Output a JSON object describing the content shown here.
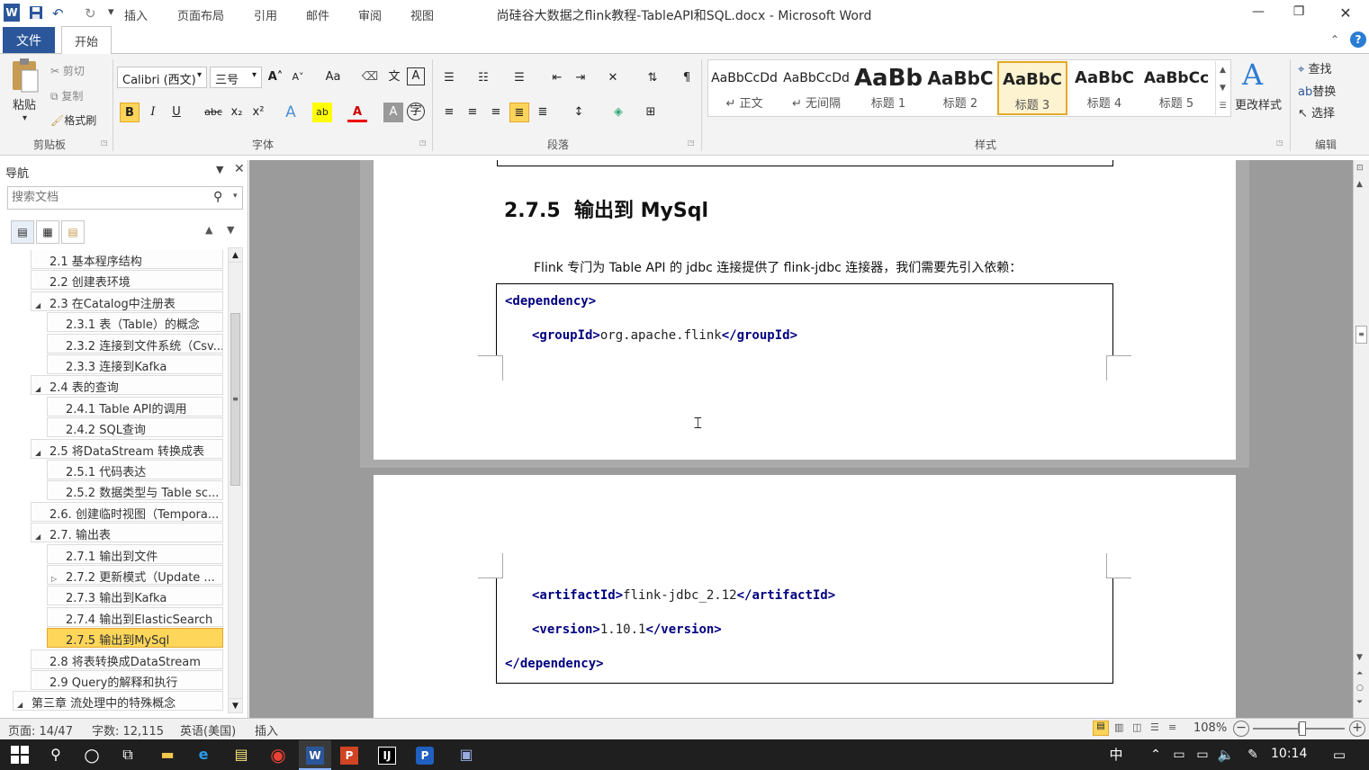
{
  "window": {
    "title": "尚硅谷大数据之flink教程-TableAPI和SQL.docx - Microsoft Word",
    "minimize": "—",
    "restore": "❐",
    "close": "✕"
  },
  "quick_access": {
    "app_icon": "W",
    "save": "💾",
    "undo": "↶",
    "redo": "↻",
    "customize": "▾"
  },
  "tabs": [
    "插入",
    "页面布局",
    "引用",
    "邮件",
    "审阅",
    "视图"
  ],
  "tab_file": "文件",
  "tab_home": "开始",
  "help": "?",
  "collapse": "⌃",
  "clipboard": {
    "paste": "粘贴",
    "cut": "剪切",
    "copy": "复制",
    "format_painter": "格式刷",
    "group": "剪贴板"
  },
  "font": {
    "name": "Calibri (西文)",
    "size": "三号",
    "group": "字体",
    "bold": "B",
    "italic": "I",
    "underline": "U",
    "strike": "abc",
    "sub": "x₂",
    "sup": "x²",
    "grow": "A˄",
    "shrink": "A˅",
    "case": "Aa",
    "clear": "A",
    "font_color": "A",
    "char_border": "A",
    "phonetic": "文",
    "enclose": "字"
  },
  "paragraph": {
    "group": "段落"
  },
  "styles": {
    "group": "样式",
    "items": [
      {
        "sample": "AaBbCcDd",
        "name": "↵ 正文"
      },
      {
        "sample": "AaBbCcDd",
        "name": "↵ 无间隔"
      },
      {
        "sample": "AaBb",
        "name": "标题 1"
      },
      {
        "sample": "AaBbC",
        "name": "标题 2"
      },
      {
        "sample": "AaBbC",
        "name": "标题 3"
      },
      {
        "sample": "AaBbC",
        "name": "标题 4"
      },
      {
        "sample": "AaBbCc",
        "name": "标题 5"
      }
    ],
    "change": "更改样式"
  },
  "editing": {
    "group": "编辑",
    "find": "查找",
    "replace": "替换",
    "select": "选择"
  },
  "nav": {
    "title": "导航",
    "search_placeholder": "搜索文档",
    "items": [
      {
        "label": "2.1 基本程序结构",
        "level": 1,
        "expander": ""
      },
      {
        "label": "2.2 创建表环境",
        "level": 1,
        "expander": ""
      },
      {
        "label": "2.3 在Catalog中注册表",
        "level": 1,
        "expander": "◢"
      },
      {
        "label": "2.3.1 表（Table）的概念",
        "level": 2,
        "expander": ""
      },
      {
        "label": "2.3.2 连接到文件系统（Csv...",
        "level": 2,
        "expander": ""
      },
      {
        "label": "2.3.3 连接到Kafka",
        "level": 2,
        "expander": ""
      },
      {
        "label": "2.4 表的查询",
        "level": 1,
        "expander": "◢"
      },
      {
        "label": "2.4.1 Table API的调用",
        "level": 2,
        "expander": ""
      },
      {
        "label": "2.4.2 SQL查询",
        "level": 2,
        "expander": ""
      },
      {
        "label": "2.5 将DataStream 转换成表",
        "level": 1,
        "expander": "◢"
      },
      {
        "label": "2.5.1 代码表达",
        "level": 2,
        "expander": ""
      },
      {
        "label": "2.5.2 数据类型与 Table sc...",
        "level": 2,
        "expander": ""
      },
      {
        "label": "2.6. 创建临时视图（Tempora...",
        "level": 1,
        "expander": ""
      },
      {
        "label": "2.7. 输出表",
        "level": 1,
        "expander": "◢"
      },
      {
        "label": "2.7.1 输出到文件",
        "level": 2,
        "expander": ""
      },
      {
        "label": "2.7.2 更新模式（Update ...",
        "level": 2,
        "expander": "▷"
      },
      {
        "label": "2.7.3 输出到Kafka",
        "level": 2,
        "expander": ""
      },
      {
        "label": "2.7.4 输出到ElasticSearch",
        "level": 2,
        "expander": ""
      },
      {
        "label": "2.7.5 输出到MySql",
        "level": 2,
        "expander": "",
        "active": true
      },
      {
        "label": "2.8 将表转换成DataStream",
        "level": 1,
        "expander": ""
      },
      {
        "label": "2.9 Query的解释和执行",
        "level": 1,
        "expander": ""
      },
      {
        "label": "第三章 流处理中的特殊概念",
        "level": 0,
        "expander": "◢"
      }
    ]
  },
  "document": {
    "heading_num": "2.7.5",
    "heading_text": "输出到 MySql",
    "paragraph": "Flink 专门为 Table API 的 jdbc 连接提供了 flink-jdbc 连接器，我们需要先引入依赖：",
    "code": [
      {
        "open": "<dependency>",
        "value": "",
        "close": ""
      },
      {
        "open": "<groupId>",
        "value": "org.apache.flink",
        "close": "</groupId>"
      },
      {
        "open": "<artifactId>",
        "value": "flink-jdbc_2.12",
        "close": "</artifactId>"
      },
      {
        "open": "<version>",
        "value": "1.10.1",
        "close": "</version>"
      },
      {
        "open": "</dependency>",
        "value": "",
        "close": ""
      }
    ]
  },
  "status": {
    "page": "页面: 14/47",
    "words": "字数: 12,115",
    "lang": "英语(美国)",
    "mode": "插入",
    "zoom": "108%",
    "zoom_level": 0.54
  },
  "taskbar": {
    "time": "10:14",
    "ime": "中"
  }
}
